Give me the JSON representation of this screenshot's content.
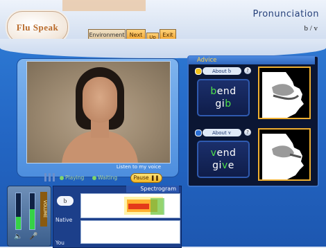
{
  "app": {
    "logo_text": "Flu Speak",
    "title": "Pronunciation",
    "pair": "b / v"
  },
  "nav": {
    "environment": "Environment",
    "next": "Next",
    "up": "Up",
    "exit": "Exit"
  },
  "video": {
    "listen_label": "Listen to my voice"
  },
  "playback": {
    "playing": "Playing",
    "waiting": "Waiting",
    "pause": "Pause"
  },
  "advice": {
    "title": "Advice",
    "cards": [
      {
        "about": "About",
        "symbol": "b",
        "words": [
          {
            "hl": "b",
            "rest": "end",
            "order": "first"
          },
          {
            "pre": "gi",
            "hl": "b"
          }
        ],
        "bulb_color": "#f2c21a"
      },
      {
        "about": "About",
        "symbol": "v",
        "words": [
          {
            "hl": "v",
            "rest": "end"
          },
          {
            "pre": "gi",
            "hl": "v",
            "post": "e"
          }
        ],
        "bulb_color": "#2a6fd6"
      }
    ],
    "help": "?"
  },
  "volume": {
    "label": "VOLUME",
    "left_level": 0.35,
    "right_level": 0.55
  },
  "spectrogram": {
    "title": "Spectrogram",
    "symbol": "b",
    "native_label": "Native",
    "you_label": "You"
  },
  "colors": {
    "accent": "#f1a12a",
    "highlight": "#4fe04a",
    "panel_blue": "#2468c6"
  },
  "icons": {
    "speaker": "speaker-icon",
    "mic": "mic-icon",
    "help": "help-icon"
  }
}
